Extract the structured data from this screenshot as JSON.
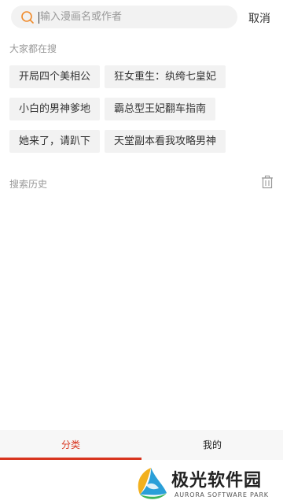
{
  "search": {
    "placeholder": "输入漫画名或作者",
    "cancel_label": "取消"
  },
  "hot_search": {
    "title": "大家都在搜",
    "tags": [
      "开局四个美相公",
      "狂女重生：纨绔七皇妃",
      "小白的男神爹地",
      "霸总型王妃翻车指南",
      "她来了，请趴下",
      "天堂副本看我攻略男神"
    ]
  },
  "history": {
    "title": "搜索历史",
    "clear_icon": "trash-icon"
  },
  "bottom_tabs": [
    {
      "label": "分类",
      "active": true
    },
    {
      "label": "我的",
      "active": false
    }
  ],
  "watermark": {
    "cn": "极光软件园",
    "en": "AURORA SOFTWARE PARK"
  },
  "colors": {
    "accent": "#d8351f",
    "search_icon": "#f08a2a",
    "chip_bg": "#f2f2f2"
  }
}
